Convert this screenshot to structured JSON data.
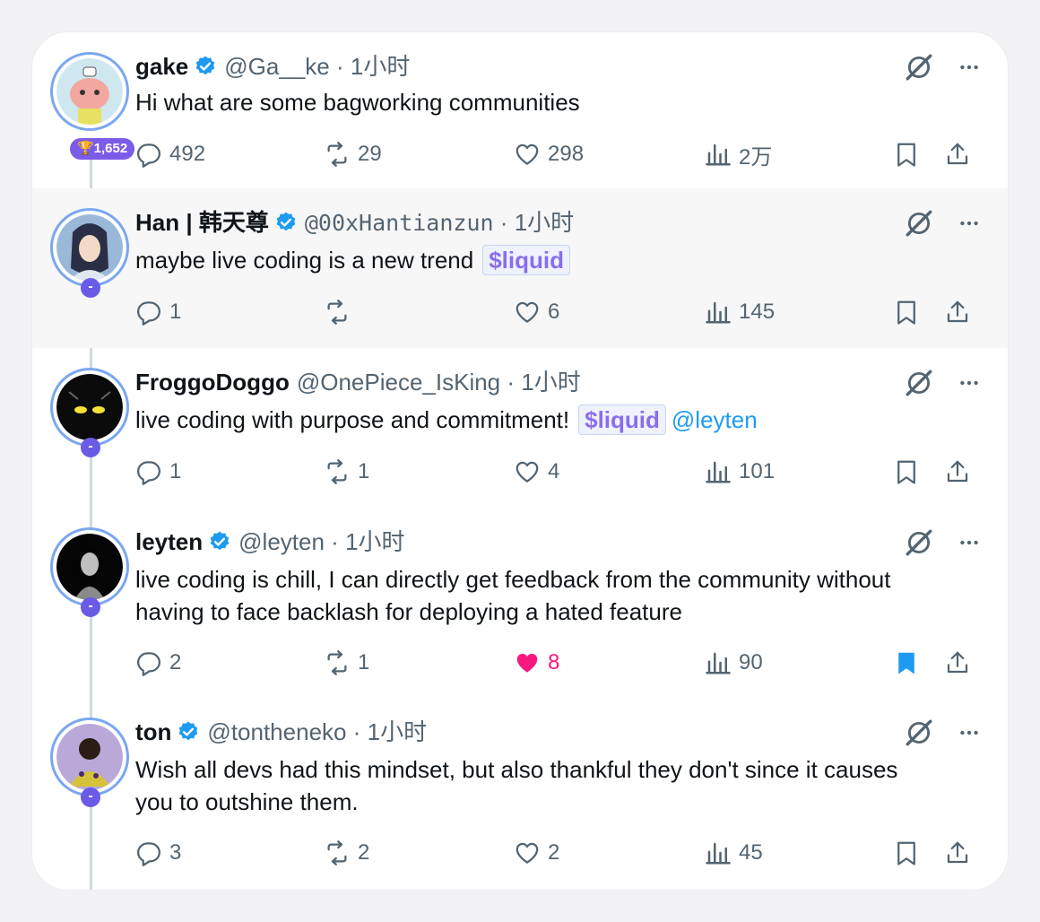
{
  "tweets": [
    {
      "name": "gake",
      "handle": "@Ga__ke",
      "time": "1小时",
      "verified": true,
      "badge": "🏆1,652",
      "text": "Hi what are some bagworking communities",
      "replies": "492",
      "reposts": "29",
      "likes": "298",
      "views": "2万",
      "liked": false,
      "bookmarked": false
    },
    {
      "name": "Han | 韩天尊",
      "handle": "@00xHantianzun",
      "time": "1小时",
      "verified": true,
      "badge": "-",
      "text": "maybe live coding is a new trend",
      "cashtag": "$liquid",
      "replies": "1",
      "reposts": "",
      "likes": "6",
      "views": "145",
      "liked": false,
      "bookmarked": false
    },
    {
      "name": "FroggoDoggo",
      "handle": "@OnePiece_IsKing",
      "time": "1小时",
      "verified": false,
      "badge": "-",
      "text": "live coding with purpose and commitment!",
      "cashtag": "$liquid",
      "mention": "@leyten",
      "replies": "1",
      "reposts": "1",
      "likes": "4",
      "views": "101",
      "liked": false,
      "bookmarked": false
    },
    {
      "name": "leyten",
      "handle": "@leyten",
      "time": "1小时",
      "verified": true,
      "badge": "-",
      "text_line1": "live coding is chill, I can directly get feedback from the community without",
      "text_line2": "having to face backlash for deploying a hated feature",
      "replies": "2",
      "reposts": "1",
      "likes": "8",
      "views": "90",
      "liked": true,
      "bookmarked": true
    },
    {
      "name": "ton",
      "handle": "@tontheneko",
      "time": "1小时",
      "verified": true,
      "badge": "-",
      "text_line1": "Wish all devs had this mindset, but also thankful they don't since it causes",
      "text_line2": "you to outshine them.",
      "replies": "3",
      "reposts": "2",
      "likes": "2",
      "views": "45",
      "liked": false,
      "bookmarked": false
    }
  ],
  "colors": {
    "accent": "#1d9bf0",
    "like": "#f91880",
    "muted": "#536471",
    "ring": "#7aa7f0",
    "badge": "#6a5be6"
  },
  "icons": [
    "reply-icon",
    "repost-icon",
    "like-icon",
    "views-icon",
    "bookmark-icon",
    "share-icon",
    "grok-icon",
    "more-icon",
    "verified-icon"
  ]
}
